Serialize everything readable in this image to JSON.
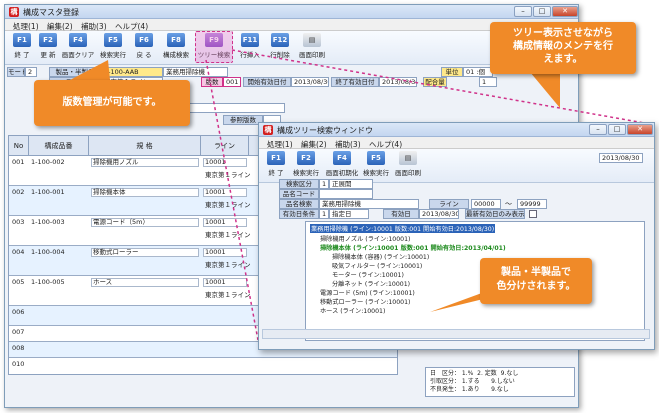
{
  "main_window": {
    "title": "構成マスタ登録",
    "menu": [
      "処理(1)",
      "編集(2)",
      "補助(3)",
      "ヘルプ(4)"
    ],
    "toolbar": [
      {
        "key": "F1",
        "label": "終 了"
      },
      {
        "key": "F2",
        "label": "更 新"
      },
      {
        "key": "F4",
        "label": "画面クリア"
      },
      {
        "key": "F5",
        "label": "検索実行"
      },
      {
        "key": "F6",
        "label": "戻 る"
      },
      {
        "key": "F8",
        "label": "構成検索"
      },
      {
        "key": "F9",
        "label": "ツリー検索"
      },
      {
        "key": "F11",
        "label": "行挿入"
      },
      {
        "key": "F12",
        "label": "行削除"
      },
      {
        "key": "",
        "label": "画面印刷"
      }
    ],
    "header": {
      "mode_label": "モード",
      "mode_value": "2",
      "product_label": "製品・半製品",
      "product_code": "1-100-AAB",
      "product_name": "業務用掃除機",
      "version_label": "版数",
      "version_value": "001",
      "start_label": "開始有効日付",
      "start_value": "2013/08/30",
      "end_label": "終了有効日付",
      "end_value": "2013/08/30",
      "unit_label": "単位",
      "unit_value": "01 :個",
      "line_label": "ライン",
      "line_value": "東京第１ライン",
      "qty_label": "配合量",
      "qty_value": "1",
      "ref_label": "参照版数"
    },
    "table": {
      "headers": [
        "No",
        "構成品番",
        "規 格",
        "ライン"
      ],
      "rows": [
        {
          "no": "001",
          "code": "1-100-002",
          "name": "掃除機用ノズル",
          "line_code": "10001",
          "line_name": "東京第１ライン"
        },
        {
          "no": "002",
          "code": "1-100-001",
          "name": "掃除機本体",
          "line_code": "10001",
          "line_name": "東京第１ライン"
        },
        {
          "no": "003",
          "code": "1-100-003",
          "name": "電源コード（5m）",
          "line_code": "10001",
          "line_name": "東京第１ライン"
        },
        {
          "no": "004",
          "code": "1-100-004",
          "name": "移動式ローラー",
          "line_code": "10001",
          "line_name": "東京第１ライン"
        },
        {
          "no": "005",
          "code": "1-100-005",
          "name": "ホース",
          "line_code": "10001",
          "line_name": "東京第１ライン"
        },
        {
          "no": "006",
          "code": "",
          "name": "",
          "line_code": "",
          "line_name": ""
        },
        {
          "no": "007",
          "code": "",
          "name": "",
          "line_code": "",
          "line_name": ""
        },
        {
          "no": "008",
          "code": "",
          "name": "",
          "line_code": "",
          "line_name": ""
        }
      ],
      "extra_row_labels": [
        "009",
        "010"
      ]
    },
    "status": [
      "日　区分： 1.%  2. 定数  9.なし",
      "引取区分： 1.する      9.しない",
      "不良発生： 1.あり      9.なし"
    ]
  },
  "tree_window": {
    "title": "構成ツリー検索ウィンドウ",
    "menu": [
      "処理(1)",
      "編集(2)",
      "補助(3)",
      "ヘルプ(4)"
    ],
    "toolbar": [
      {
        "key": "F1",
        "label": "終 了"
      },
      {
        "key": "F2",
        "label": "検索実行"
      },
      {
        "key": "F4",
        "label": "画面初期化"
      },
      {
        "key": "F5",
        "label": "検索実行"
      },
      {
        "key": "",
        "label": "画面印刷"
      }
    ],
    "date": "2013/08/30",
    "form": {
      "search_type_label": "検索区分",
      "search_type_value": "1",
      "search_type_name": "正展開",
      "item_code_label": "品名コード",
      "item_name_label": "品名検索",
      "item_name_value": "業務用掃除機",
      "line_label": "ライン",
      "line_from": "00000",
      "line_to": "99999",
      "range_mark": "～",
      "valid_date_label": "有効日条件",
      "valid_date_value": "1",
      "valid_date_name": "指定日",
      "date_label": "有効日",
      "date_value": "2013/08/30",
      "latest_label": "最新有効日のみ表示"
    },
    "tree": [
      "業務用掃除機 (ライン:10001 版数:001 開始有効日:2013/08/30)",
      "掃除機用ノズル (ライン:10001)",
      "掃除機本体 (ライン:10001 版数:001 開始有効日:2013/04/01)",
      "掃除機本体 (容器) (ライン:10001)",
      "吸気フィルター (ライン:10001)",
      "モーター (ライン:10001)",
      "分離ネット (ライン:10001)",
      "電源コード (5m) (ライン:10001)",
      "移動式ローラー (ライン:10001)",
      "ホース (ライン:10001)"
    ]
  },
  "callouts": {
    "tree_display": "ツリー表示させながら\n構成情報のメンテを行\nえます。",
    "version_mgmt": "版数管理が可能です。",
    "color_coded": "製品・半製品で\n色分けされます。"
  },
  "colors": {
    "callout": "#f08a28",
    "highlight": "#d0328a",
    "accent": "#2b63b8"
  }
}
